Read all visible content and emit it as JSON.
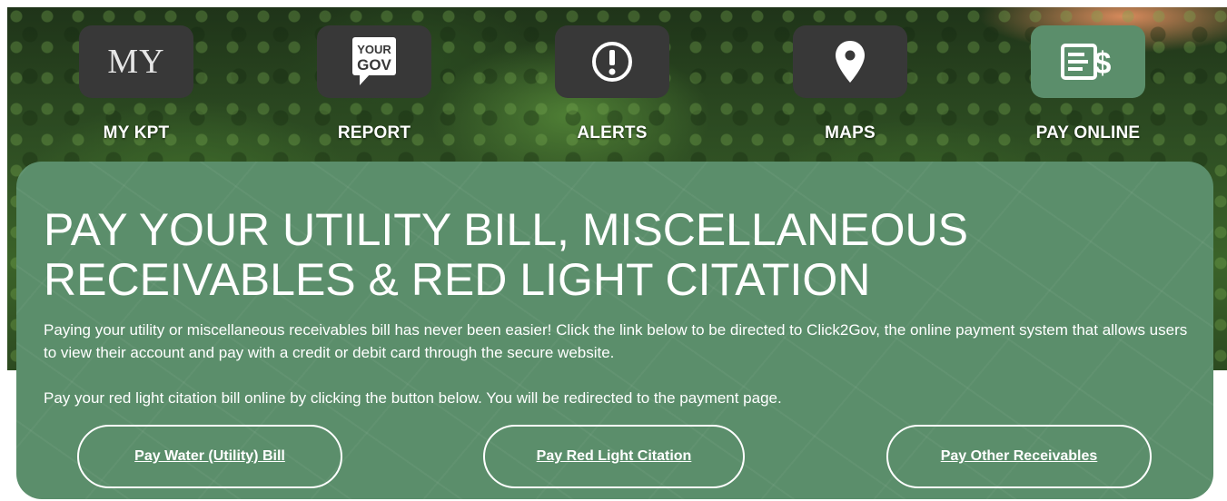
{
  "nav": {
    "items": [
      {
        "label": "MY KPT",
        "icon": "my-logo-icon",
        "icon_text": "MY",
        "active": false
      },
      {
        "label": "REPORT",
        "icon": "your-gov-icon",
        "icon_text_top": "YOUR",
        "icon_text_bottom": "GOV",
        "active": false
      },
      {
        "label": "ALERTS",
        "icon": "alert-icon",
        "active": false
      },
      {
        "label": "MAPS",
        "icon": "map-pin-icon",
        "active": false
      },
      {
        "label": "PAY ONLINE",
        "icon": "bill-dollar-icon",
        "active": true
      }
    ]
  },
  "panel": {
    "title": "PAY YOUR UTILITY BILL, MISCELLANEOUS RECEIVABLES & RED LIGHT CITATION",
    "paragraph1": "Paying your utility or miscellaneous receivables bill has never been easier! Click the link below to be directed to Click2Gov, the online payment system that allows users to view their account and pay with a credit or debit card through the secure website.",
    "paragraph2": "Pay your red light citation bill online by clicking the button below. You will be redirected to the payment page.",
    "buttons": [
      {
        "label": "Pay Water (Utility) Bill"
      },
      {
        "label": "Pay Red Light Citation"
      },
      {
        "label": "Pay Other Receivables"
      }
    ]
  },
  "colors": {
    "accent_green": "#5b8e6b",
    "tile_dark": "#383838",
    "text_white": "#ffffff"
  }
}
